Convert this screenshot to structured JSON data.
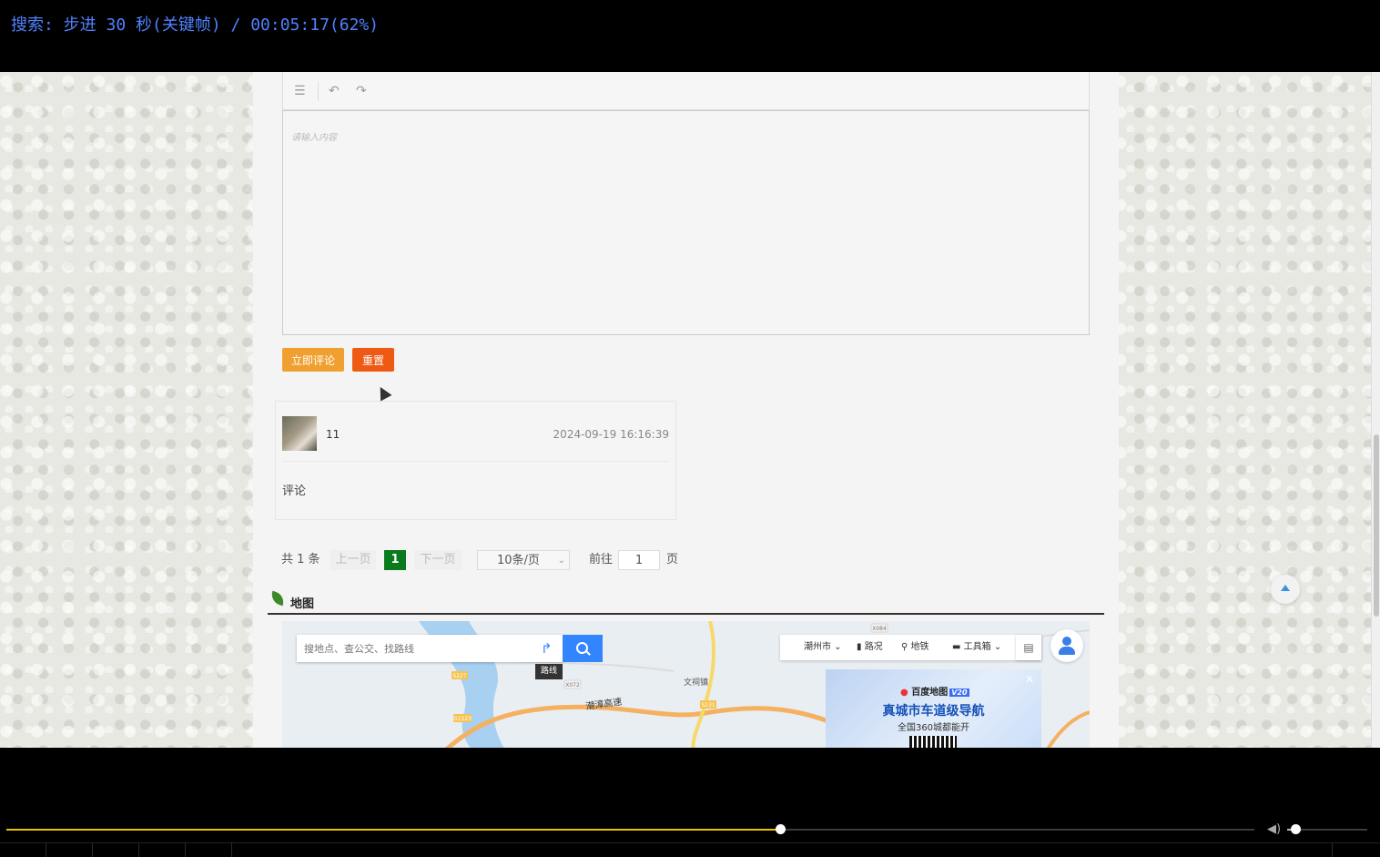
{
  "osd": {
    "text": "搜索: 步进 30 秒(关键帧) / 00:05:17(62%)"
  },
  "editor": {
    "placeholder": "请输入内容"
  },
  "buttons": {
    "submit": "立即评论",
    "reset": "重置"
  },
  "comment": {
    "user": "11",
    "time": "2024-09-19 16:16:39",
    "text": "评论"
  },
  "pagination": {
    "total": "共 1 条",
    "prev": "上一页",
    "current": "1",
    "next": "下一页",
    "page_size": "10条/页",
    "goto": "前往",
    "goto_value": "1",
    "page_unit": "页"
  },
  "map": {
    "heading": "地图",
    "search_placeholder": "搜地点、查公交、找路线",
    "route_tooltip": "路线",
    "tools": {
      "city": "潮州市",
      "traffic": "路况",
      "subway": "地铁",
      "toolbox": "工具箱"
    },
    "labels": {
      "expressway": "潮漳高速",
      "town": "文祠镇",
      "road1": "S227",
      "road2": "X072",
      "road3": "S231",
      "road4": "X084",
      "road5": "G1523"
    },
    "ad": {
      "brand": "百度地图",
      "version": "V20",
      "headline": "真城市车道级导航",
      "subline": "全国360城都能开"
    }
  },
  "player": {
    "progress": 0.62,
    "volume": 0.1
  },
  "colors": {
    "accent_submit": "#f0a030",
    "accent_reset": "#ee5a14",
    "page_active": "#0a7a1e",
    "progress": "#e8c400",
    "map_blue": "#3385ff"
  }
}
